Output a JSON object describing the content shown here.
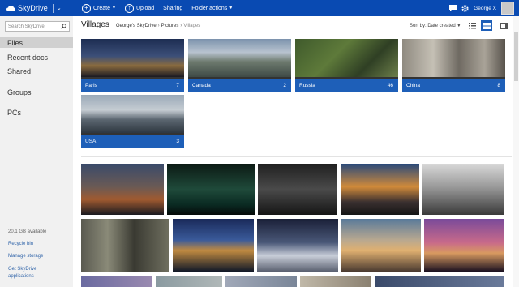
{
  "app": {
    "name": "SkyDrive",
    "colors": {
      "topbar": "#094ab2",
      "accent": "#1e5fb8",
      "sidebar": "#f1f1f1"
    }
  },
  "toolbar": {
    "create_label": "Create",
    "upload_label": "Upload",
    "sharing_label": "Sharing",
    "folder_actions_label": "Folder actions",
    "user_name": "George X"
  },
  "sidebar": {
    "search_placeholder": "Search SkyDrive",
    "nav": [
      "Files",
      "Recent docs",
      "Shared",
      "Groups",
      "PCs"
    ],
    "storage_available": "20.1 GB available",
    "links": [
      "Recycle bin",
      "Manage storage"
    ],
    "get_app_line1": "Get SkyDrive",
    "get_app_line2": "applications"
  },
  "main": {
    "title": "Villages",
    "breadcrumb": [
      "George's SkyDrive",
      "Pictures",
      "Villages"
    ],
    "sort_label": "Sort by: Date created"
  },
  "folders": [
    {
      "name": "Paris",
      "count": "7",
      "icon": "night-city-photo"
    },
    {
      "name": "Canada",
      "count": "2",
      "icon": "mountain-city-photo"
    },
    {
      "name": "Russia",
      "count": "46",
      "icon": "aerial-tower-photo"
    },
    {
      "name": "China",
      "count": "8",
      "icon": "skyscrapers-photo"
    },
    {
      "name": "USA",
      "count": "3",
      "icon": "skyline-photo"
    }
  ],
  "photo_count": 15
}
